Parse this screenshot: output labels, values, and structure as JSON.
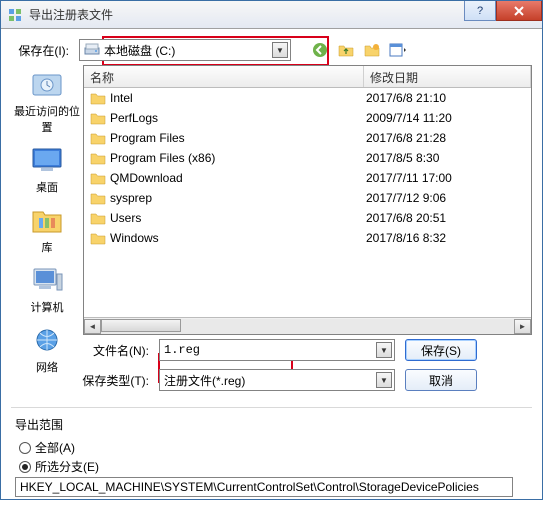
{
  "window": {
    "title": "导出注册表文件"
  },
  "labels": {
    "save_in": "保存在(I):",
    "filename": "文件名(N):",
    "filetype": "保存类型(T):",
    "scope_header": "导出范围",
    "scope_all": "全部(A)",
    "scope_branch": "所选分支(E)"
  },
  "location": {
    "selected": " 本地磁盘 (C:)"
  },
  "columns": {
    "name": "名称",
    "date": "修改日期"
  },
  "files": [
    {
      "name": "Intel",
      "date": "2017/6/8 21:10"
    },
    {
      "name": "PerfLogs",
      "date": "2009/7/14 11:20"
    },
    {
      "name": "Program Files",
      "date": "2017/6/8 21:28"
    },
    {
      "name": "Program Files (x86)",
      "date": "2017/8/5 8:30"
    },
    {
      "name": "QMDownload",
      "date": "2017/7/11 17:00"
    },
    {
      "name": "sysprep",
      "date": "2017/7/12 9:06"
    },
    {
      "name": "Users",
      "date": "2017/6/8 20:51"
    },
    {
      "name": "Windows",
      "date": "2017/8/16 8:32"
    }
  ],
  "places": {
    "recent": "最近访问的位置",
    "desktop": "桌面",
    "library": "库",
    "computer": "计算机",
    "network": "网络"
  },
  "inputs": {
    "filename_value": "1.reg",
    "filetype_value": "注册文件(*.reg)"
  },
  "buttons": {
    "save": "保存(S)",
    "cancel": "取消"
  },
  "branch_path": "HKEY_LOCAL_MACHINE\\SYSTEM\\CurrentControlSet\\Control\\StorageDevicePolicies"
}
